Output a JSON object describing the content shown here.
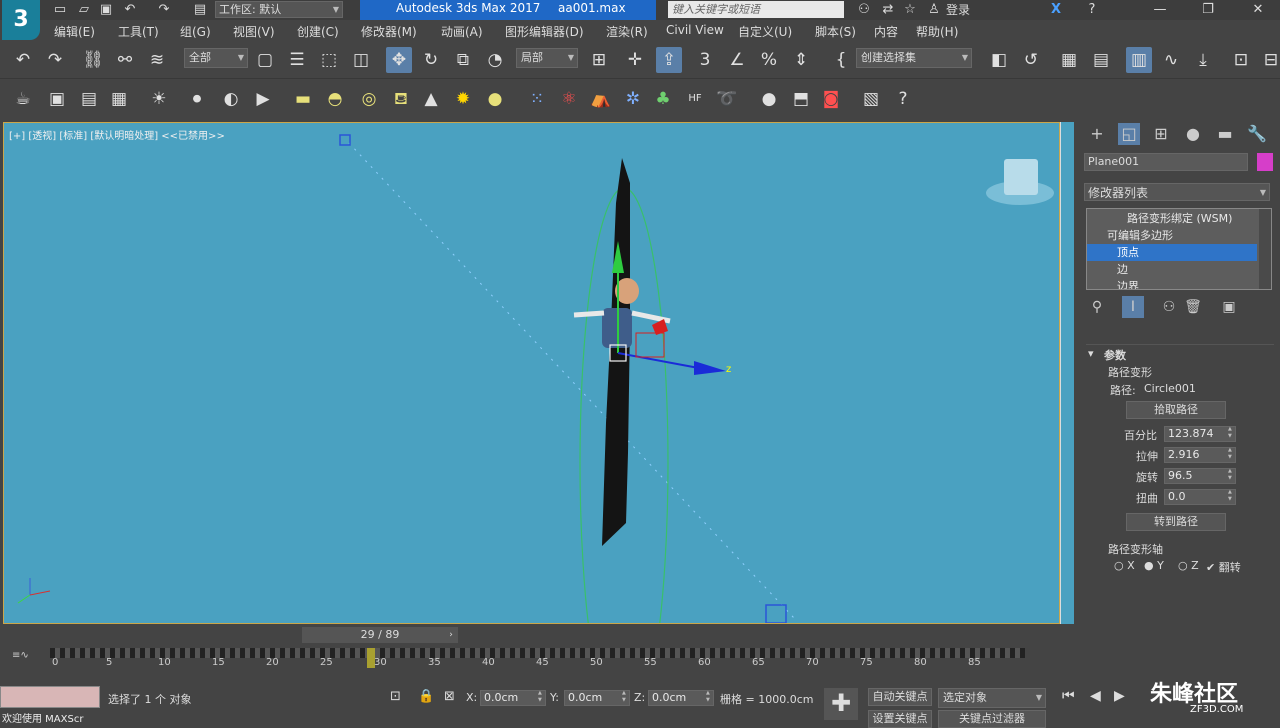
{
  "titlebar": {
    "logo": "3",
    "workspace": "工作区: 默认",
    "app_title": "Autodesk 3ds Max 2017",
    "file_name": "aa001.max",
    "search_placeholder": "键入关键字或短语",
    "login": "登录"
  },
  "menubar": {
    "items": [
      "编辑(E)",
      "工具(T)",
      "组(G)",
      "视图(V)",
      "创建(C)",
      "修改器(M)",
      "动画(A)",
      "图形编辑器(D)",
      "渲染(R)",
      "Civil View",
      "自定义(U)",
      "脚本(S)",
      "内容",
      "帮助(H)"
    ]
  },
  "toolbar1": {
    "selection_filter": "全部",
    "ref_coord": "局部",
    "named_selection": "创建选择集"
  },
  "viewport": {
    "label": "[+] [透视] [标准] [默认明暗处理] <<已禁用>>",
    "gizmo_label": "z"
  },
  "command_panel": {
    "object_name": "Plane001",
    "object_color": "#d63ec9",
    "modifier_list": "修改器列表",
    "stack": [
      {
        "label": "路径变形绑定 (WSM)",
        "indent": 1
      },
      {
        "label": "可编辑多边形",
        "indent": 0
      },
      {
        "label": "顶点",
        "indent": 2
      },
      {
        "label": "边",
        "indent": 2
      },
      {
        "label": "边界",
        "indent": 2
      }
    ],
    "rollout_title": "参数",
    "group_path_deform": "路径变形",
    "path_label": "路径:",
    "path_value": "Circle001",
    "pick_path": "拾取路径",
    "percent_label": "百分比",
    "percent_value": "123.874",
    "stretch_label": "拉伸",
    "stretch_value": "2.916",
    "rotation_label": "旋转",
    "rotation_value": "96.5",
    "twist_label": "扭曲",
    "twist_value": "0.0",
    "move_to_path": "转到路径",
    "group_axis": "路径变形轴",
    "axis_x": "X",
    "axis_y": "Y",
    "axis_z": "Z",
    "flip": "翻转"
  },
  "timeline": {
    "frame_display": "29 / 89",
    "ticks": [
      "0",
      "5",
      "10",
      "15",
      "20",
      "25",
      "30",
      "35",
      "40",
      "45",
      "50",
      "55",
      "60",
      "65",
      "70",
      "75",
      "80",
      "85"
    ]
  },
  "statusbar": {
    "maxscript": "欢迎使用 MAXScr",
    "selection_status": "选择了 1 个 对象",
    "x_label": "X:",
    "x_value": "0.0cm",
    "y_label": "Y:",
    "y_value": "0.0cm",
    "z_label": "Z:",
    "z_value": "0.0cm",
    "grid": "栅格 = 1000.0cm",
    "auto_key": "自动关键点",
    "selected_object": "选定对象",
    "set_key": "设置关键点",
    "key_filter": "关键点过滤器"
  },
  "watermark": {
    "main": "朱峰社区",
    "sub": "ZF3D.COM"
  }
}
